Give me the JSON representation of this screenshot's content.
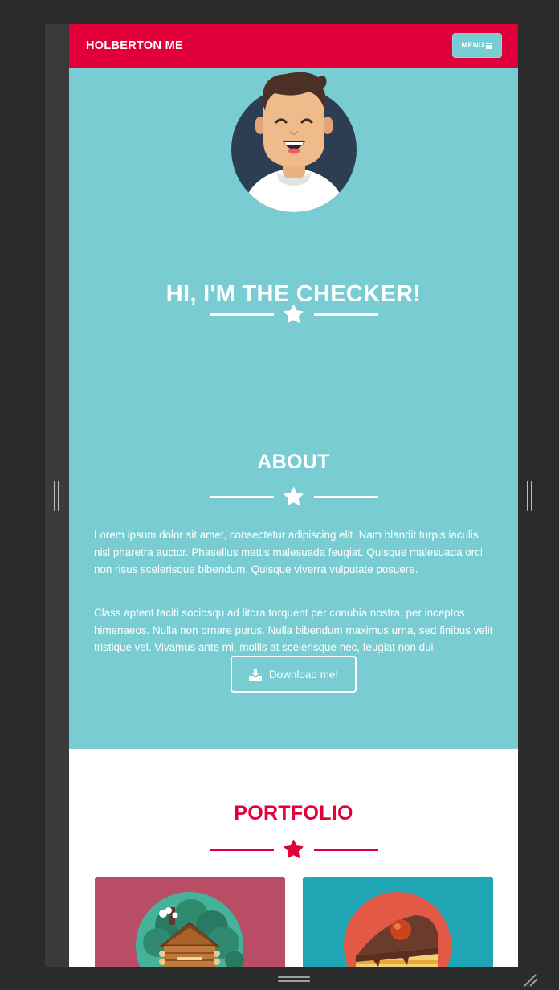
{
  "navbar": {
    "brand": "HOLBERTON ME",
    "menu_label": "MENU",
    "menu_icon": "hamburger-icon"
  },
  "hero": {
    "title": "HI, I'M THE CHECKER!",
    "avatar_icon": "avatar-illustration",
    "divider_icon": "star-icon"
  },
  "about": {
    "title": "ABOUT",
    "divider_icon": "star-icon",
    "paragraphs": [
      "Lorem ipsum dolor sit amet, consectetur adipiscing elit. Nam blandit turpis iaculis nisl pharetra auctor. Phasellus mattis malesuada feugiat. Quisque malesuada orci non risus scelerisque bibendum. Quisque viverra vulputate posuere.",
      "Class aptent taciti sociosqu ad litora torquent per conubia nostra, per inceptos himenaeos. Nulla non ornare purus. Nulla bibendum maximus urna, sed finibus velit tristique vel. Vivamus ante mi, mollis at scelerisque nec, feugiat non dui."
    ],
    "download_label": "Download me!",
    "download_icon": "download-icon"
  },
  "portfolio": {
    "title": "PORTFOLIO",
    "divider_icon": "star-icon",
    "items": [
      {
        "icon": "cabin-icon"
      },
      {
        "icon": "cake-icon"
      }
    ]
  },
  "colors": {
    "brand_red": "#e2003b",
    "teal": "#79cdd2",
    "white": "#ffffff",
    "card_red": "#b94d65",
    "card_teal": "#20a5b5"
  }
}
